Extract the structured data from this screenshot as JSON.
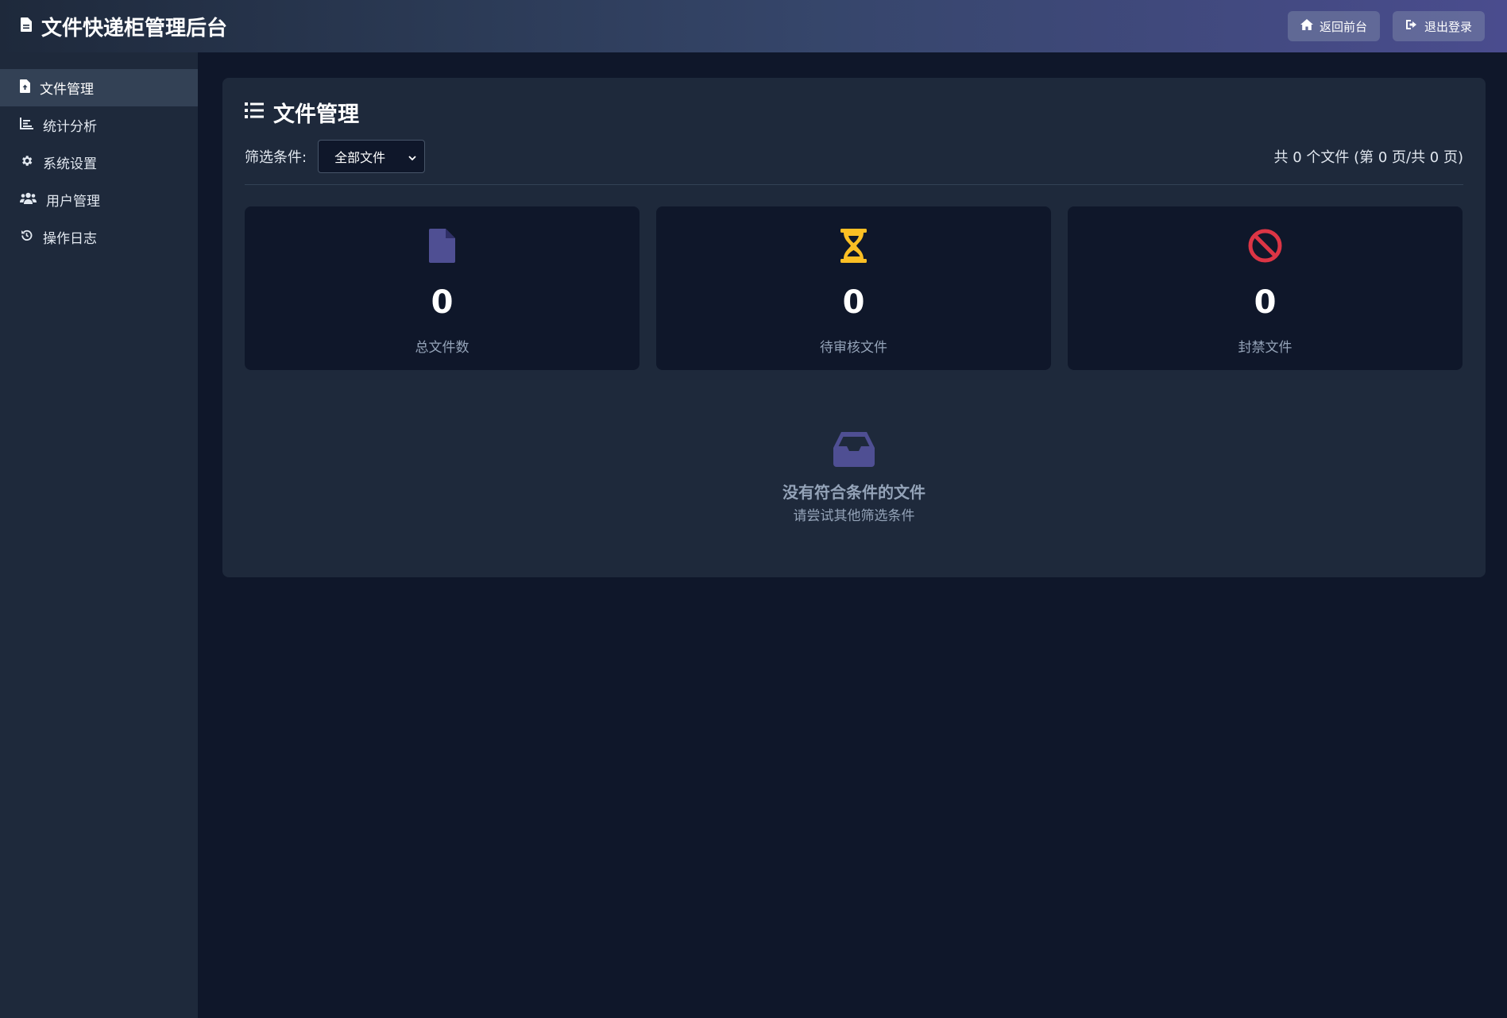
{
  "header": {
    "title": "文件快递柜管理后台",
    "home_button": "返回前台",
    "logout_button": "退出登录"
  },
  "sidebar": {
    "items": [
      {
        "label": "文件管理",
        "icon": "file-upload-icon",
        "active": true
      },
      {
        "label": "统计分析",
        "icon": "chart-icon"
      },
      {
        "label": "系统设置",
        "icon": "gear-icon"
      },
      {
        "label": "用户管理",
        "icon": "users-icon"
      },
      {
        "label": "操作日志",
        "icon": "history-icon"
      }
    ]
  },
  "main": {
    "title": "文件管理",
    "filter_label": "筛选条件:",
    "filter_selected": "全部文件",
    "file_count": "共 0 个文件 (第 0 页/共 0 页)",
    "stats": [
      {
        "value": "0",
        "label": "总文件数",
        "icon": "file-icon",
        "color": "#4f4f93"
      },
      {
        "value": "0",
        "label": "待审核文件",
        "icon": "hourglass-icon",
        "color": "#fbbf24"
      },
      {
        "value": "0",
        "label": "封禁文件",
        "icon": "ban-icon",
        "color": "#dc3545"
      }
    ],
    "empty": {
      "title": "没有符合条件的文件",
      "subtitle": "请尝试其他筛选条件",
      "icon": "inbox-icon"
    }
  },
  "colors": {
    "background": "#0f172a",
    "panel": "#1e293b",
    "accent": "#4f4f93"
  }
}
